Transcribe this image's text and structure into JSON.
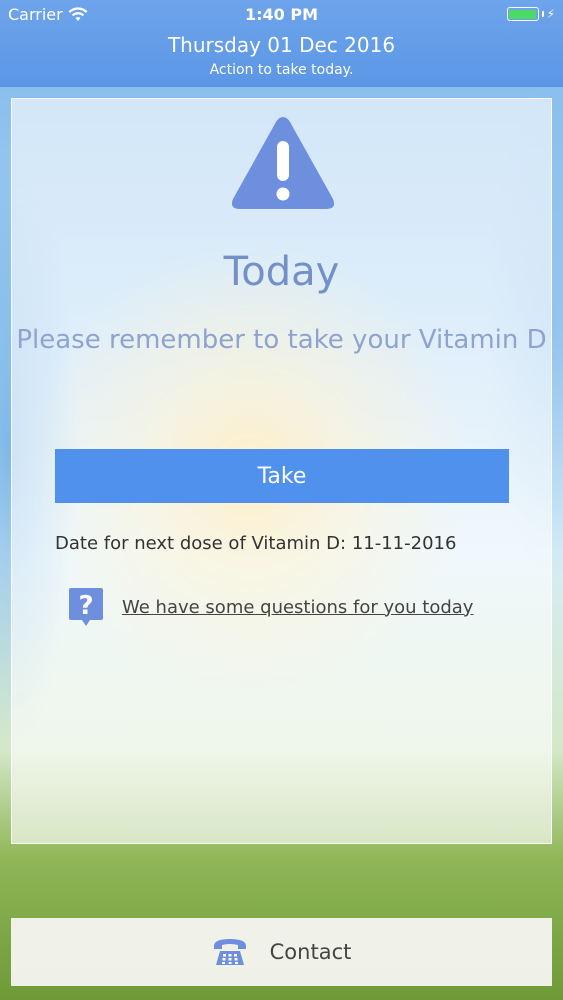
{
  "status_bar": {
    "carrier": "Carrier",
    "time": "1:40 PM"
  },
  "header": {
    "title": "Thursday 01 Dec 2016",
    "subtitle": "Action to take today."
  },
  "main": {
    "alert_icon": "warning-triangle-icon",
    "heading": "Today",
    "reminder": "Please remember to take your Vitamin D",
    "take_button": "Take",
    "next_dose": "Date for next dose of Vitamin D: 11-11-2016",
    "questions_link": "We have some questions for you today"
  },
  "footer": {
    "contact_label": "Contact",
    "contact_icon": "telephone-icon"
  },
  "colors": {
    "header_bg": "#5b96e6",
    "accent": "#4f91ec",
    "heading_text": "#7390c9",
    "icon_blue": "#6d8fdd",
    "battery": "#4cd964"
  }
}
